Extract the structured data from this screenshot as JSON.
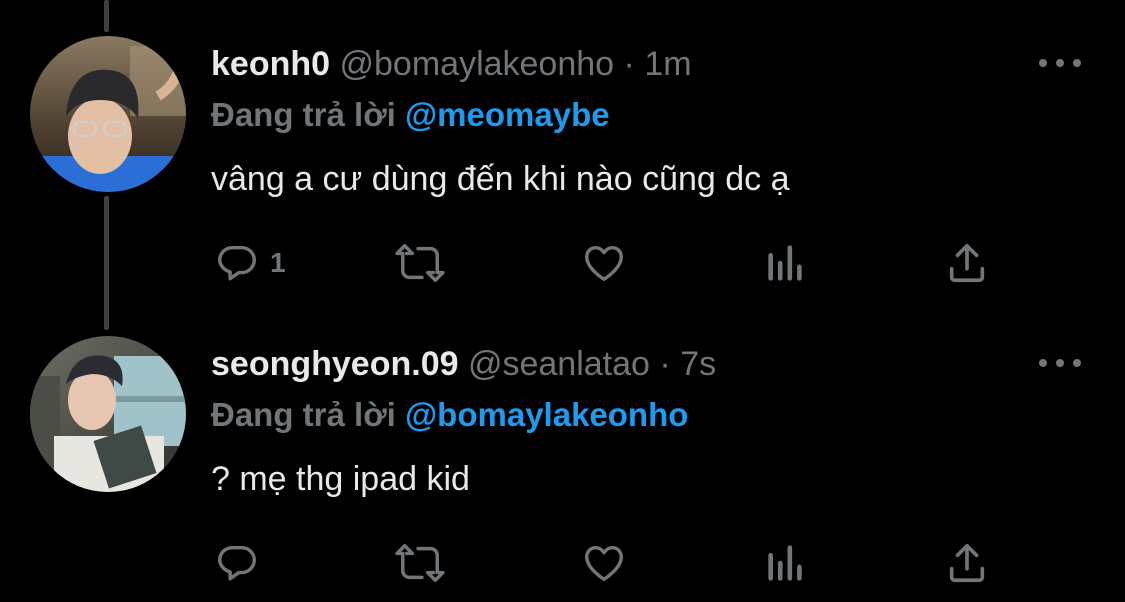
{
  "tweets": [
    {
      "name": "keonh0",
      "handle": "@bomaylakeonho",
      "dot": "·",
      "time": "1m",
      "reply_prefix": "Đang trả lời",
      "reply_to": "@meomaybe",
      "text": "vâng a cư dùng đến khi nào cũng dc ạ",
      "reply_count": "1",
      "avatar_icon": "profile-photo"
    },
    {
      "name": "seonghyeon.09",
      "handle": "@seanlatao",
      "dot": "·",
      "time": "7s",
      "reply_prefix": "Đang trả lời",
      "reply_to": "@bomaylakeonho",
      "text": "? mẹ thg ipad kid",
      "reply_count": "",
      "avatar_icon": "profile-photo"
    }
  ],
  "icons": {
    "reply": "speech-bubble-icon",
    "retweet": "retweet-icon",
    "like": "heart-icon",
    "views": "bar-chart-icon",
    "share": "share-icon",
    "more": "more-dots-icon"
  },
  "colors": {
    "background": "#000000",
    "text": "#e7e9ea",
    "muted": "#71767b",
    "accent": "#1d9bf0"
  }
}
